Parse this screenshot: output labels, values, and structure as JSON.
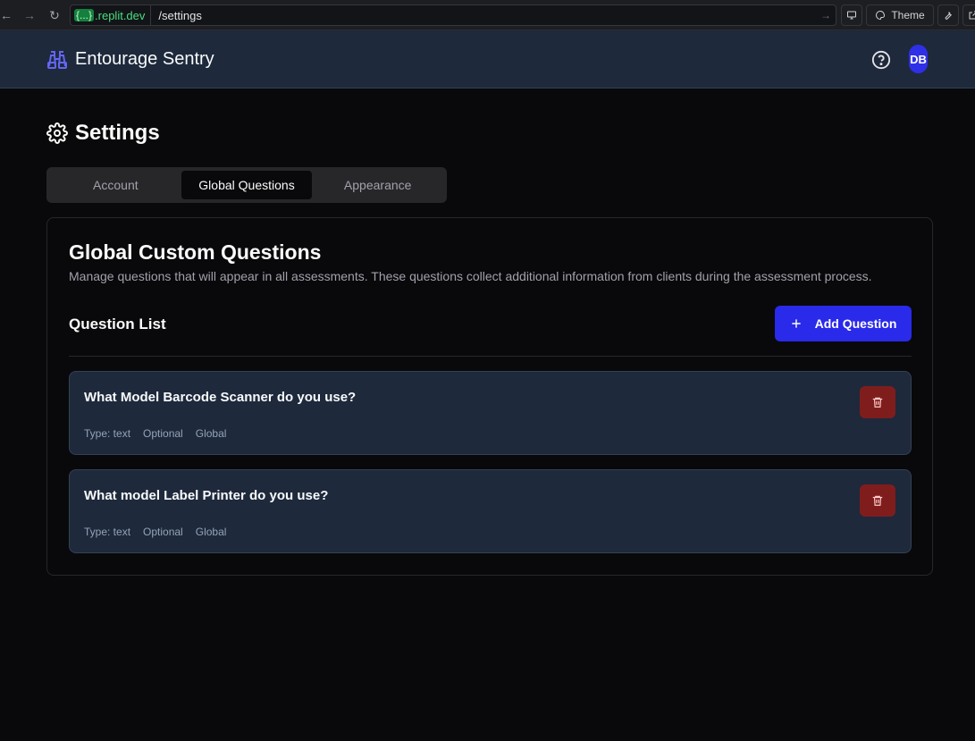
{
  "browser": {
    "host_badge": "{...}",
    "host_text": ".replit.dev",
    "path": "/settings",
    "theme_label": "Theme"
  },
  "header": {
    "app_name": "Entourage Sentry",
    "avatar_initials": "DB"
  },
  "page": {
    "title": "Settings"
  },
  "tabs": [
    {
      "label": "Account",
      "active": false
    },
    {
      "label": "Global Questions",
      "active": true
    },
    {
      "label": "Appearance",
      "active": false
    }
  ],
  "card": {
    "title": "Global Custom Questions",
    "description": "Manage questions that will appear in all assessments. These questions collect additional information from clients during the assessment process.",
    "list_title": "Question List",
    "add_button_label": "Add Question"
  },
  "questions": [
    {
      "text": "What Model Barcode Scanner do you use?",
      "type": "Type: text",
      "required": "Optional",
      "scope": "Global"
    },
    {
      "text": "What model Label Printer do you use?",
      "type": "Type: text",
      "required": "Optional",
      "scope": "Global"
    }
  ],
  "colors": {
    "accent": "#2a2aea",
    "danger": "#7f1d1d",
    "header_bg": "#1e293b",
    "page_bg": "#09090b"
  }
}
